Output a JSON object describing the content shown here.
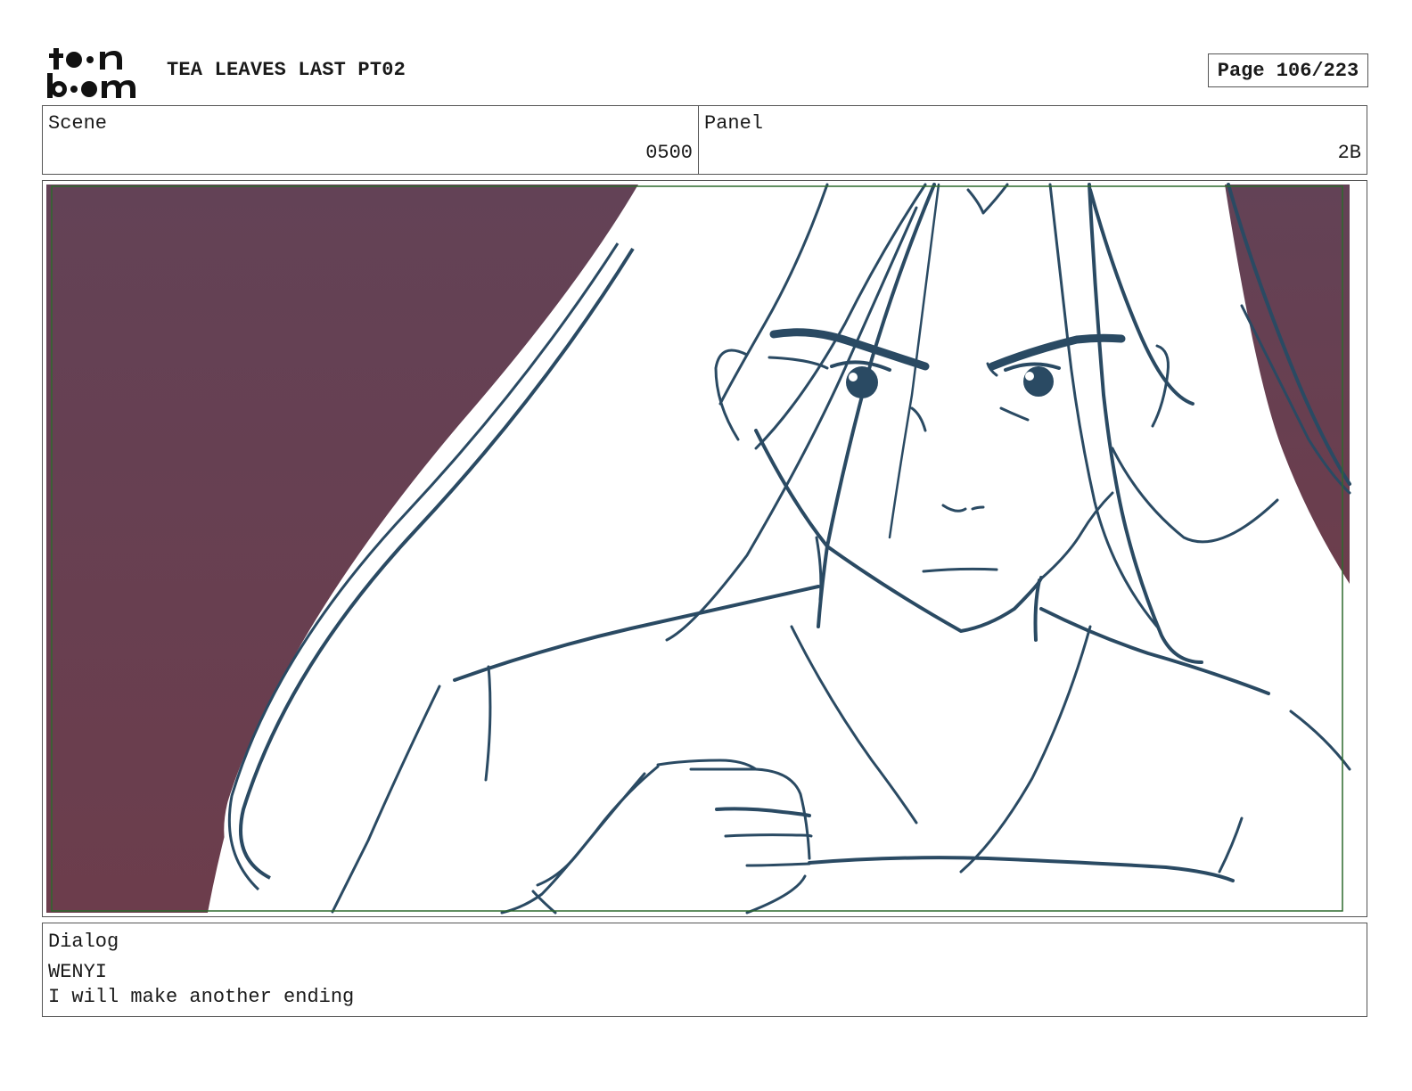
{
  "header": {
    "logo_text": "toon boom",
    "title": "TEA LEAVES LAST PT02",
    "page_label": "Page 106/223"
  },
  "info": {
    "scene_label": "Scene",
    "scene_value": "0500",
    "panel_label": "Panel",
    "panel_value": "2B"
  },
  "frame": {
    "image_description_icon": "storyboard-sketch-image",
    "colors": {
      "background_wall": "#66404f",
      "line_art": "#2a4a63",
      "safe_frame": "#2d6a2d"
    }
  },
  "dialog": {
    "label": "Dialog",
    "character": "WENYI",
    "line": "I will make another ending"
  }
}
